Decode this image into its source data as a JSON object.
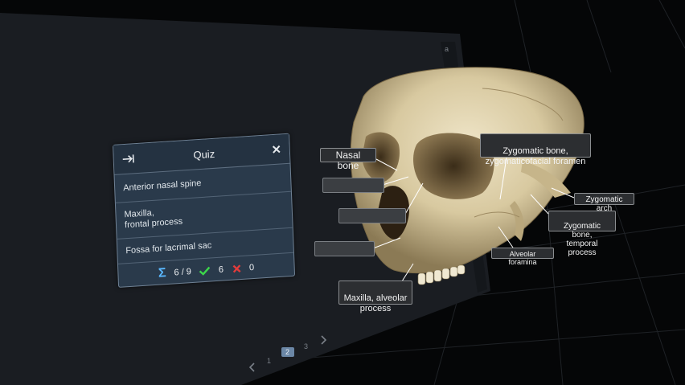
{
  "quiz": {
    "title": "Quiz",
    "items": [
      {
        "label": "Anterior nasal spine"
      },
      {
        "label": "Maxilla,\nfrontal process"
      },
      {
        "label": "Fossa for lacrimal sac"
      }
    ],
    "score": {
      "progress": "6 / 9",
      "correct": "6",
      "wrong": "0"
    }
  },
  "labels": [
    {
      "text": "Nasal bone"
    },
    {
      "text": "Zygomatic bone,\nzygomaticofacial foramen"
    },
    {
      "text": "Zygomatic arch"
    },
    {
      "text": "Zygomatic bone,\ntemporal process"
    },
    {
      "text": "Alveolar foramina"
    },
    {
      "text": "Maxilla, alveolar\nprocess"
    }
  ],
  "pager": {
    "pages": [
      "1",
      "2",
      "3"
    ],
    "current": "2"
  },
  "colors": {
    "panel": "#2a3a4b",
    "sigma": "#5ab8ff",
    "check": "#3cd64a",
    "cross": "#e23b3b"
  }
}
